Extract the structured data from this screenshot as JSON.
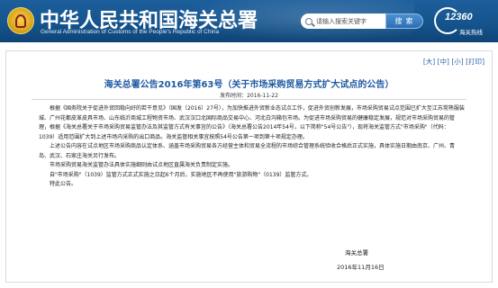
{
  "header": {
    "title": "中华人民共和国海关总署",
    "subtitle": "General Administration of Customs of the People's Republic of China",
    "search_placeholder": "请输入搜索关键字",
    "search_button": "搜索",
    "hotline_number": "12360",
    "hotline_label": "海关热线",
    "colors": {
      "background": "#15548d",
      "accent": "#1f5aa3"
    }
  },
  "font_size": {
    "open": "[",
    "large": "大",
    "sep1": "]",
    "open2": "[",
    "medium": "中",
    "sep2": "]",
    "open3": "[",
    "small": "小",
    "sep3": "]",
    "open4": "[",
    "print": "打印",
    "close": "]"
  },
  "article": {
    "title": "海关总署公告2016年第63号（关于市场采购贸易方式扩大试点的公告）",
    "date": "发布时间：2016-11-22",
    "paragraphs": [
      "根据《国务院关于促进外贸回稳向好的若干意见》（国发〔2016〕27号），为加快推进外贸新业态试点工作，促进外贸创新发展，市场采购贸易试点范围已扩大至江苏常熟服装城、广州花都皮革皮具市场、山东临沂商城工程物资市场、武汉汉口北国际商品交易中心、河北白沟箱包市场。为促进市场采购贸易的健康稳定发展，规范对市场采购贸易的管理，根据《海关总署关于市场采购贸易监管办法及其监管方式有关事宜的公告》（海关总署公告2014年54号，以下简称\"54号公告\"），现将海关监管方式\"市场采购\"（代码：1039）适用范围扩大到上述市场内采购的出口商品。海关监管相关事宜按照54号公告第一项到第十项规定办理。",
      "上述公告内容在试点地区市场采购商品认定体系、涵盖市场采购贸易各方经营主体和贸易全流程的市场综合管理系统验收合格后正式实施，具体实施日期由南京、广州、青岛、武汉、石家庄海关另行发布。",
      "市场采购贸易海关监管办法具体实施细则由试点地区直属海关负责制定实施。",
      "自\"市场采购\"（1039）监管方式正式实施之日起6个月后，实施地区不再使用\"旅游购物\"（0139）监管方式。",
      "特此公告。"
    ],
    "signature_org": "海关总署",
    "signature_date": "2016年11月16日"
  }
}
